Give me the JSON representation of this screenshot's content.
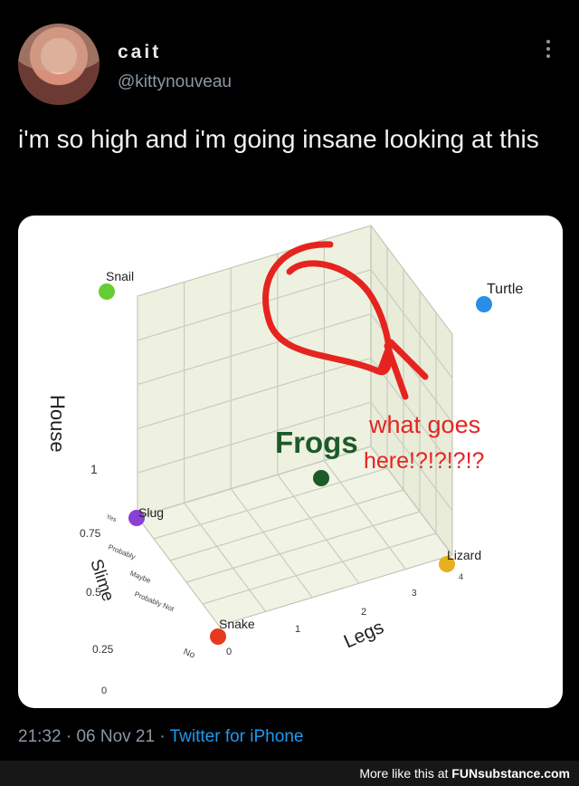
{
  "tweet": {
    "display_name": "cait",
    "handle": "@kittynouveau",
    "text": "i'm so high and i'm going insane looking at this",
    "time": "21:32",
    "date": "06 Nov 21",
    "source": "Twitter for iPhone",
    "separator": "·"
  },
  "chart_data": {
    "type": "scatter3d",
    "axes": {
      "house": {
        "label": "House",
        "ticks": [
          "0",
          "0.25",
          "0.5",
          "0.75",
          "1"
        ]
      },
      "slime": {
        "label": "Slime",
        "ticks": [
          "No",
          "Probably Not",
          "Maybe",
          "Probably",
          "Yes"
        ]
      },
      "legs": {
        "label": "Legs",
        "ticks": [
          "0",
          "1",
          "2",
          "3",
          "4"
        ]
      }
    },
    "points": [
      {
        "name": "Snail",
        "house": 1,
        "slime": "Yes",
        "legs": 0,
        "color": "#66cc33"
      },
      {
        "name": "Turtle",
        "house": 1,
        "slime": "No",
        "legs": 4,
        "color": "#2a8ee6"
      },
      {
        "name": "Slug",
        "house": 0,
        "slime": "Yes",
        "legs": 0,
        "color": "#8a3fd6"
      },
      {
        "name": "Snake",
        "house": 0,
        "slime": "No",
        "legs": 0,
        "color": "#e63a1e"
      },
      {
        "name": "Lizard",
        "house": 0,
        "slime": "No",
        "legs": 4,
        "color": "#e6b01e"
      },
      {
        "name": "Frogs",
        "color": "#1d5a2a"
      }
    ],
    "annotation": {
      "text_line1": "what goes",
      "text_line2": "here!?!?!?!?",
      "color": "#e52420"
    },
    "frogs_label_color": "#1d5a2a"
  },
  "footer": {
    "promo_prefix": "More like this at ",
    "promo_site": "FUNsubstance.com"
  }
}
